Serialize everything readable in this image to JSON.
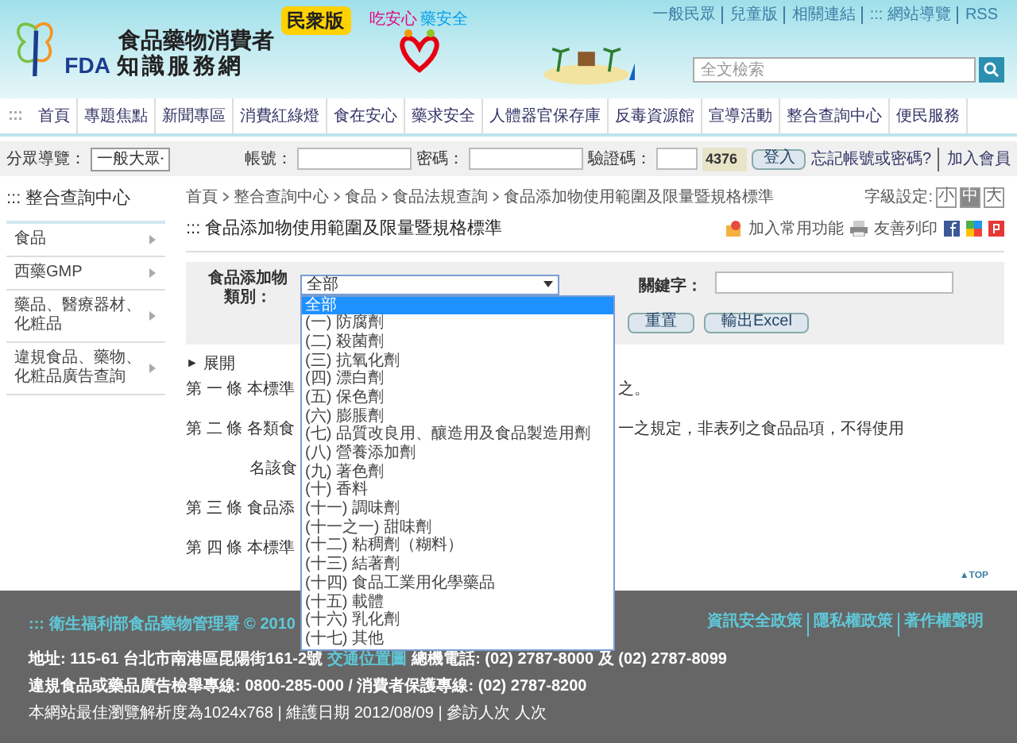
{
  "header": {
    "logo_top": "食品藥物消費者",
    "logo_fda": "FDA",
    "logo_bottom": "知識服務網",
    "edition_badge": "民衆版",
    "slogan_1": "吃安心",
    "slogan_2": "藥安全",
    "top_links": [
      "一般民眾",
      "兒童版",
      "相關連結",
      "::: 網站導覽",
      "RSS"
    ],
    "search": {
      "placeholder": "全文檢索"
    }
  },
  "nav": {
    "items": [
      {
        "label": "首頁",
        "selected": false
      },
      {
        "label": "專題焦點",
        "selected": false
      },
      {
        "label": "新聞專區",
        "selected": false
      },
      {
        "label": "消費紅綠燈",
        "selected": false
      },
      {
        "label": "食在安心",
        "selected": false
      },
      {
        "label": "藥求安全",
        "selected": false
      },
      {
        "label": "人體器官保存庫",
        "selected": false
      },
      {
        "label": "反毒資源館",
        "selected": false
      },
      {
        "label": "宣導活動",
        "selected": false
      },
      {
        "label": "整合查詢中心",
        "selected": false
      },
      {
        "label": "便民服務",
        "selected": false
      }
    ]
  },
  "login_bar": {
    "audience_label": "分眾導覽：",
    "audience_value": "一般大眾",
    "account_label": "帳號：",
    "password_label": "密碼：",
    "captcha_label": "驗證碼：",
    "captcha_code": "4376",
    "login_button": "登入",
    "forgot_link": "忘記帳號或密碼?",
    "join_link": "加入會員"
  },
  "sidebar": {
    "title": "::: 整合查詢中心",
    "items": [
      "食品",
      "西藥GMP",
      "藥品、醫療器材、化粧品",
      "違規食品、藥物、化粧品廣告查詢"
    ]
  },
  "breadcrumb": [
    "首頁",
    "整合查詢中心",
    "食品",
    "食品法規查詢",
    "食品添加物使用範圍及限量暨規格標準"
  ],
  "font_size": {
    "label": "字級設定:",
    "options": [
      {
        "label": "小",
        "selected": false
      },
      {
        "label": "中",
        "selected": true
      },
      {
        "label": "大",
        "selected": false
      }
    ]
  },
  "page_title": "::: 食品添加物使用範圍及限量暨規格標準",
  "actions": [
    "加入常用功能",
    "友善列印"
  ],
  "search_form": {
    "category_label": "食品添加物類別：",
    "category_value": "全部",
    "keyword_label": "關鍵字：",
    "buttons": [
      "重置",
      "輸出Excel"
    ],
    "options": [
      {
        "label": "全部",
        "selected": true
      },
      {
        "label": "(一) 防腐劑",
        "selected": false
      },
      {
        "label": "(二) 殺菌劑",
        "selected": false
      },
      {
        "label": "(三) 抗氧化劑",
        "selected": false
      },
      {
        "label": "(四) 漂白劑",
        "selected": false
      },
      {
        "label": "(五) 保色劑",
        "selected": false
      },
      {
        "label": "(六) 膨脹劑",
        "selected": false
      },
      {
        "label": "(七) 品質改良用、釀造用及食品製造用劑",
        "selected": false
      },
      {
        "label": "(八) 營養添加劑",
        "selected": false
      },
      {
        "label": "(九) 著色劑",
        "selected": false
      },
      {
        "label": "(十) 香料",
        "selected": false
      },
      {
        "label": "(十一) 調味劑",
        "selected": false
      },
      {
        "label": "(十一之一) 甜味劑",
        "selected": false
      },
      {
        "label": "(十二) 粘稠劑（糊料）",
        "selected": false
      },
      {
        "label": "(十三) 結著劑",
        "selected": false
      },
      {
        "label": "(十四) 食品工業用化學藥品",
        "selected": false
      },
      {
        "label": "(十五) 載體",
        "selected": false
      },
      {
        "label": "(十六) 乳化劑",
        "selected": false
      },
      {
        "label": "(十七) 其他",
        "selected": false
      }
    ]
  },
  "expand_toggle": {
    "icon": "►",
    "label": "展開"
  },
  "articles": [
    {
      "left": "第 一 條 本標準",
      "right": "之。",
      "indent": false
    },
    {
      "left": "第 二 條 各類食",
      "right": "一之規定，非表列之食品品項，不得使用",
      "indent": false
    },
    {
      "left": "名該食",
      "indent": true
    },
    {
      "left": "第 三 條 食品添",
      "indent": false
    },
    {
      "left": "第 四 條 本標準",
      "indent": false
    }
  ],
  "top_link": "▲TOP",
  "footer": {
    "agency": "::: 衛生福利部食品藥物管理署 © 2010",
    "policy_links": [
      "資訊安全政策",
      "隱私權政策",
      "著作權聲明"
    ],
    "address_prefix": "地址: 115-61 台北市南港區昆陽街161-2號",
    "map_link": "交通位置圖",
    "address_suffix": "總機電話: (02) 2787-8000 及 (02) 2787-8099",
    "line_2": "違規食品或藥品廣告檢舉專線: 0800-285-000 / 消費者保護專線: (02) 2787-8200",
    "line_3": "本網站最佳瀏覽解析度為1024x768 | 維護日期 2012/08/09 | 參訪人次 人次"
  }
}
